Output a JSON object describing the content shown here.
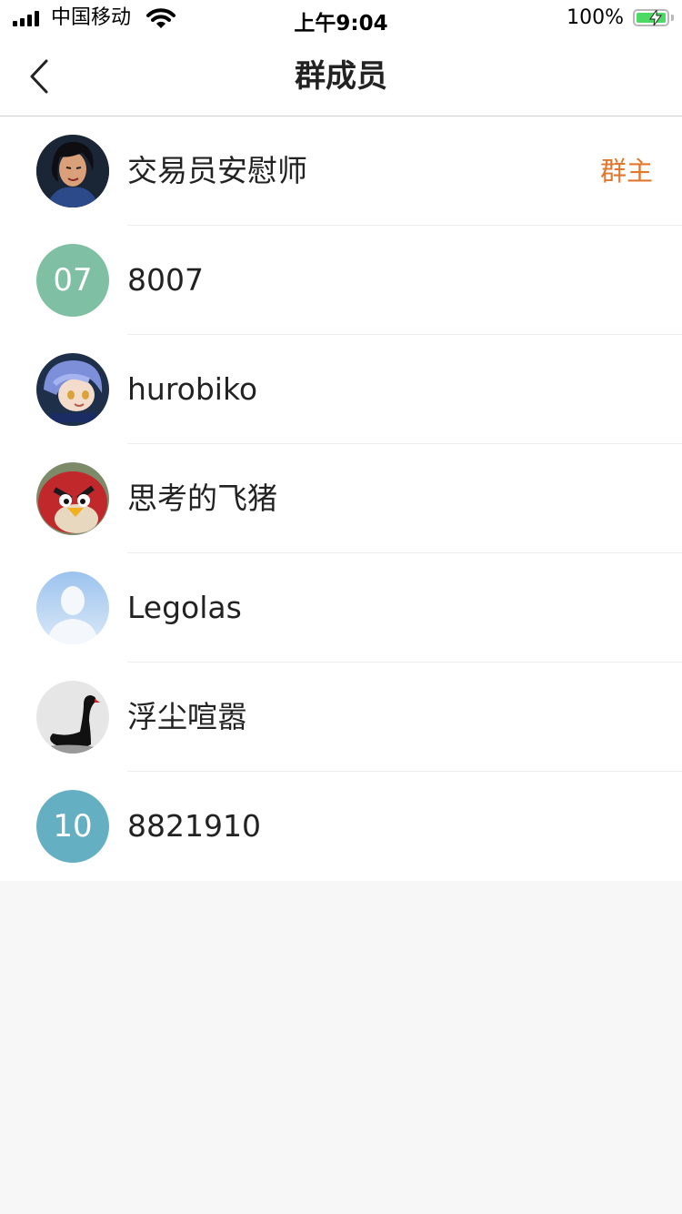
{
  "status_bar": {
    "carrier": "中国移动",
    "time": "上午9:04",
    "battery_percent": "100%",
    "signal_icon": "signal-bars-icon",
    "wifi_icon": "wifi-icon",
    "battery_icon": "battery-charging-icon"
  },
  "nav": {
    "title": "群成员",
    "back_icon": "chevron-left-icon"
  },
  "members": [
    {
      "name": "交易员安慰师",
      "role": "群主",
      "avatar": {
        "type": "image",
        "label": ""
      }
    },
    {
      "name": "8007",
      "role": "",
      "avatar": {
        "type": "text",
        "label": "07",
        "color": "#7fbfa4"
      }
    },
    {
      "name": "hurobiko",
      "role": "",
      "avatar": {
        "type": "image",
        "label": ""
      }
    },
    {
      "name": "思考的飞猪",
      "role": "",
      "avatar": {
        "type": "image",
        "label": ""
      }
    },
    {
      "name": "Legolas",
      "role": "",
      "avatar": {
        "type": "image",
        "label": ""
      }
    },
    {
      "name": "浮尘喧嚣",
      "role": "",
      "avatar": {
        "type": "image",
        "label": ""
      }
    },
    {
      "name": "8821910",
      "role": "",
      "avatar": {
        "type": "text",
        "label": "10",
        "color": "#64b0c2"
      }
    }
  ],
  "colors": {
    "owner_badge": "#e0772c",
    "background": "#f7f7f7"
  }
}
